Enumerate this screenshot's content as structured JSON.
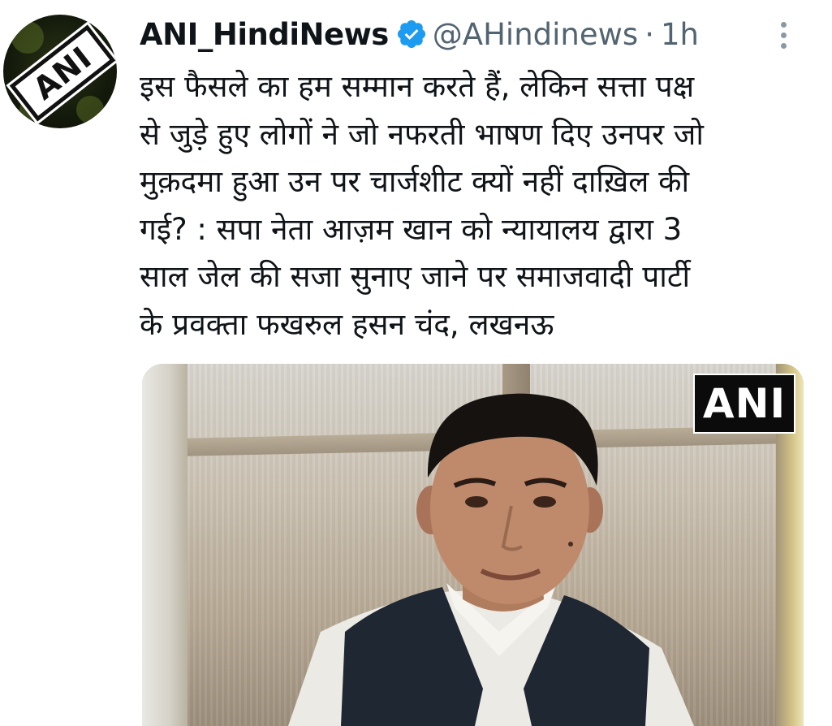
{
  "tweet": {
    "author": {
      "display_name": "ANI_HindiNews",
      "handle": "@AHindinews",
      "separator": "·",
      "time": "1h",
      "verified": true,
      "avatar_logo_text": "ANI"
    },
    "text_lines": [
      "इस फैसले का हम सम्मान करते हैं, लेकिन सत्ता पक्ष",
      "से जुड़े हुए लोगों ने जो नफरती भाषण दिए उनपर जो",
      "मुक़दमा हुआ उन पर चार्जशीट क्यों नहीं दाख़िल की",
      "गई? : सपा नेता आज़म खान को न्यायालय द्वारा 3",
      "साल जेल की सजा सुनाए जाने पर समाजवादी पार्टी",
      "के प्रवक्ता फखरुल हसन चंद, लखनऊ"
    ],
    "media": {
      "watermark": "ANI"
    }
  },
  "icons": {
    "verified": "verified-badge-icon",
    "more": "more-options-icon"
  },
  "colors": {
    "text": "#0f1419",
    "secondary": "#536471",
    "verified_blue": "#1d9bf0",
    "background": "#ffffff"
  }
}
